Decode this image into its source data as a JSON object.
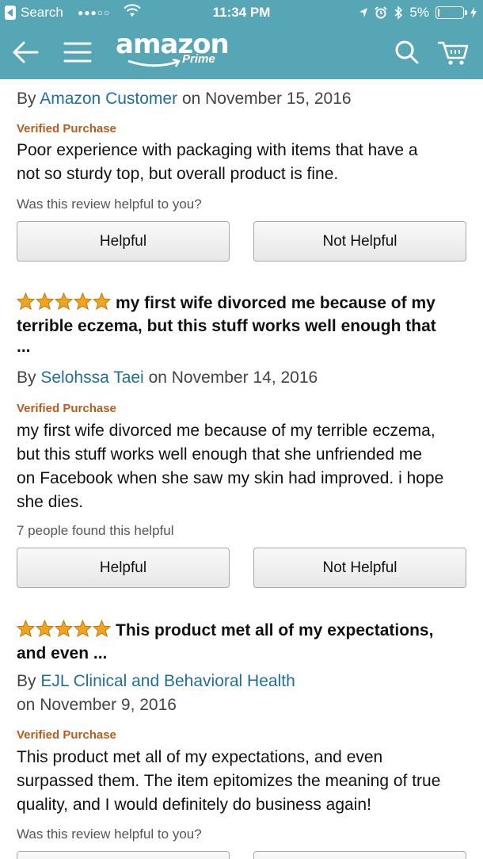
{
  "status_bar": {
    "back_app": "Search",
    "signal": "●●●○○",
    "time": "11:34 PM",
    "battery": "5%",
    "battery_level": 0.05
  },
  "nav": {
    "brand": "amazon",
    "sub_brand": "Prime"
  },
  "reviews": [
    {
      "byline_prefix": "By",
      "author": "Amazon Customer",
      "date": "on November 15, 2016",
      "verified": "Verified Purchase",
      "text_lines": [
        "Poor experience with packaging with items that have a",
        "not so sturdy top, but overall product is fine."
      ],
      "helpful_text": "Was this review helpful to you?",
      "helpful_label": "Helpful",
      "not_helpful_label": "Not Helpful"
    },
    {
      "rating": 5,
      "title_lines": [
        "my first wife divorced me because of my",
        "terrible eczema, but this stuff works well enough that",
        "..."
      ],
      "byline_prefix": "By",
      "author": "Selohssa Taei",
      "date": "on November 14, 2016",
      "verified": "Verified Purchase",
      "text_lines": [
        "my first wife divorced me because of my terrible eczema,",
        "but this stuff works well enough that she unfriended me",
        "on Facebook when she saw my skin had improved. i hope",
        "she dies."
      ],
      "helpful_text": "7 people found this helpful",
      "helpful_label": "Helpful",
      "not_helpful_label": "Not Helpful"
    },
    {
      "rating": 5,
      "title_lines": [
        "This product met all of my expectations,",
        "and even ..."
      ],
      "byline_prefix": "By",
      "author": "EJL Clinical and Behavioral Health",
      "date": "on November 9, 2016",
      "verified": "Verified Purchase",
      "text_lines": [
        "This product met all of my expectations, and even",
        "surpassed them. The item epitomizes the meaning of true",
        "quality, and I would definitely do business again!"
      ],
      "helpful_text": "Was this review helpful to you?"
    }
  ],
  "colors": {
    "header": "#56a6b6",
    "author_link": "#1f6f9a",
    "verified": "#b55d1e",
    "star": "#f0a31f"
  }
}
